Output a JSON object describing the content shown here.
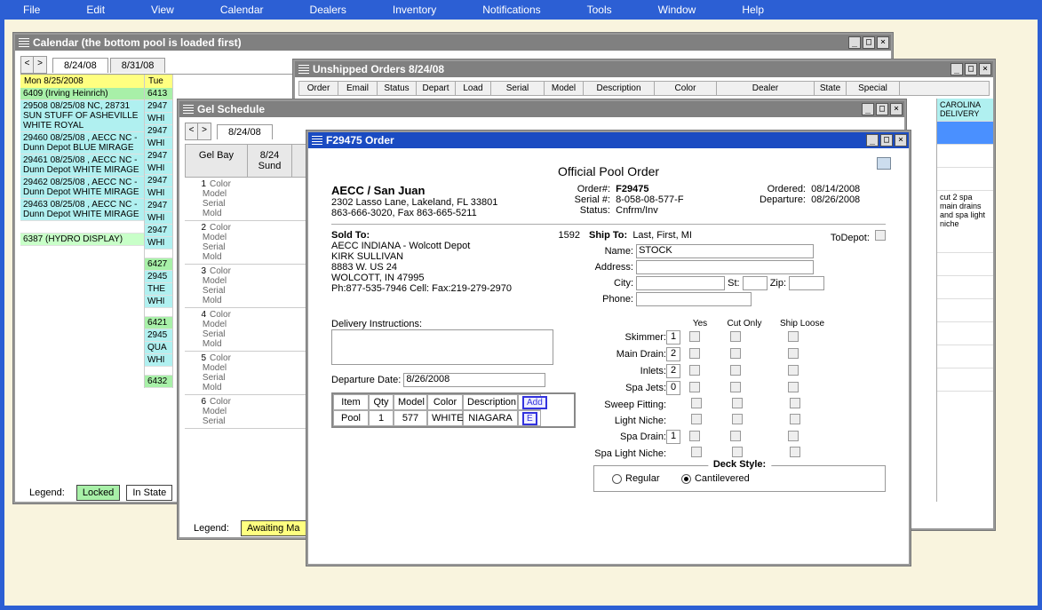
{
  "menu": [
    "File",
    "Edit",
    "View",
    "Calendar",
    "Dealers",
    "Inventory",
    "Notifications",
    "Tools",
    "Window",
    "Help"
  ],
  "calendar_win": {
    "title": "Calendar (the bottom pool is loaded first)",
    "tabs": [
      "8/24/08",
      "8/31/08"
    ],
    "day1_head": "Mon  8/25/2008",
    "day1": [
      "6409 (Irving Heinrich)",
      "29508 08/25/08 NC, 28731 SUN STUFF OF ASHEVILLE WHITE ROYAL",
      "29460 08/25/08 , AECC NC - Dunn Depot BLUE MIRAGE",
      "29461 08/25/08 , AECC NC - Dunn Depot WHITE MIRAGE",
      "29462 08/25/08 , AECC NC - Dunn Depot WHITE MIRAGE",
      "29463 08/25/08 , AECC NC - Dunn Depot WHITE MIRAGE",
      "",
      "6387 (HYDRO DISPLAY)"
    ],
    "day2_head": "Tue",
    "day2": [
      "6413",
      "2947",
      "WHI",
      "2947",
      "WHI",
      "2947",
      "WHI",
      "2947",
      "WHI",
      "2947",
      "WHI",
      "2947",
      "WHI",
      "",
      "6427",
      "2945",
      "THE",
      "WHI",
      "",
      "6421",
      "2945",
      "QUA",
      "WHI",
      "",
      "6432"
    ],
    "legend_label": "Legend:",
    "legend_locked": "Locked",
    "legend_instate": "In State"
  },
  "unshipped_win": {
    "title": "Unshipped Orders 8/24/08",
    "cols": [
      "Order",
      "Email",
      "Status",
      "Depart",
      "Load",
      "Serial",
      "Model",
      "Description",
      "Color",
      "Dealer",
      "State",
      "Special"
    ],
    "special_vals": [
      "CAROLINA DELIVERY",
      "",
      "",
      "",
      "cut 2 spa main drains and spa light niche",
      "",
      "",
      "",
      "",
      "",
      ""
    ]
  },
  "gel_win": {
    "title": "Gel Schedule",
    "tabs": [
      "8/24/08"
    ],
    "col_headers": [
      "Gel Bay",
      "8/24 Sund"
    ],
    "rowlabels": [
      "Color",
      "Model",
      "Serial",
      "Mold"
    ],
    "rows": [
      1,
      2,
      3,
      4,
      5,
      6
    ],
    "legend_label": "Legend:",
    "legend_awaiting": "Awaiting Ma"
  },
  "order_win": {
    "title": "F29475 Order",
    "heading": "Official Pool Order",
    "company": "AECC / San Juan",
    "addr1": "2302 Lasso Lane, Lakeland, FL 33801",
    "addr2": "863-666-3020, Fax 863-665-5211",
    "order_lbl": "Order#:",
    "order_val": "F29475",
    "serial_lbl": "Serial #:",
    "serial_val": "8-058-08-577-F",
    "status_lbl": "Status:",
    "status_val": "Cnfrm/Inv",
    "ordered_lbl": "Ordered:",
    "ordered_val": "08/14/2008",
    "departure_lbl": "Departure:",
    "departure_val": "08/26/2008",
    "soldto_lbl": "Sold To:",
    "soldto_num": "1592",
    "soldto_lines": [
      "AECC INDIANA - Wolcott Depot",
      "KIRK SULLIVAN",
      "8883 W. US 24",
      "WOLCOTT, IN 47995",
      "Ph:877-535-7946 Cell: Fax:219-279-2970"
    ],
    "shipto_lbl": "Ship To:",
    "shipto_hint": "Last, First, MI",
    "todepot_lbl": "ToDepot:",
    "name_lbl": "Name:",
    "name_val": "STOCK",
    "address_lbl": "Address:",
    "city_lbl": "City:",
    "st_lbl": "St:",
    "zip_lbl": "Zip:",
    "phone_lbl": "Phone:",
    "deliv_lbl": "Delivery Instructions:",
    "depdate_lbl": "Departure Date:",
    "depdate_val": "8/26/2008",
    "items_cols": [
      "Item",
      "Qty",
      "Model",
      "Color",
      "Description"
    ],
    "add_btn": "Add",
    "item_row": {
      "item": "Pool",
      "qty": "1",
      "model": "577",
      "color": "WHITE",
      "desc": "NIAGARA",
      "e": "E"
    },
    "choice_hdr": {
      "yes": "Yes",
      "cut": "Cut Only",
      "ship": "Ship Loose"
    },
    "choices": [
      {
        "label": "Skimmer:",
        "val": "1"
      },
      {
        "label": "Main Drain:",
        "val": "2"
      },
      {
        "label": "Inlets:",
        "val": "2"
      },
      {
        "label": "Spa Jets:",
        "val": "0"
      },
      {
        "label": "Sweep Fitting:",
        "val": ""
      },
      {
        "label": "Light Niche:",
        "val": ""
      },
      {
        "label": "Spa Drain:",
        "val": "1"
      },
      {
        "label": "Spa Light Niche:",
        "val": ""
      }
    ],
    "deck_lbl": "Deck Style:",
    "deck_regular": "Regular",
    "deck_cant": "Cantilevered"
  }
}
